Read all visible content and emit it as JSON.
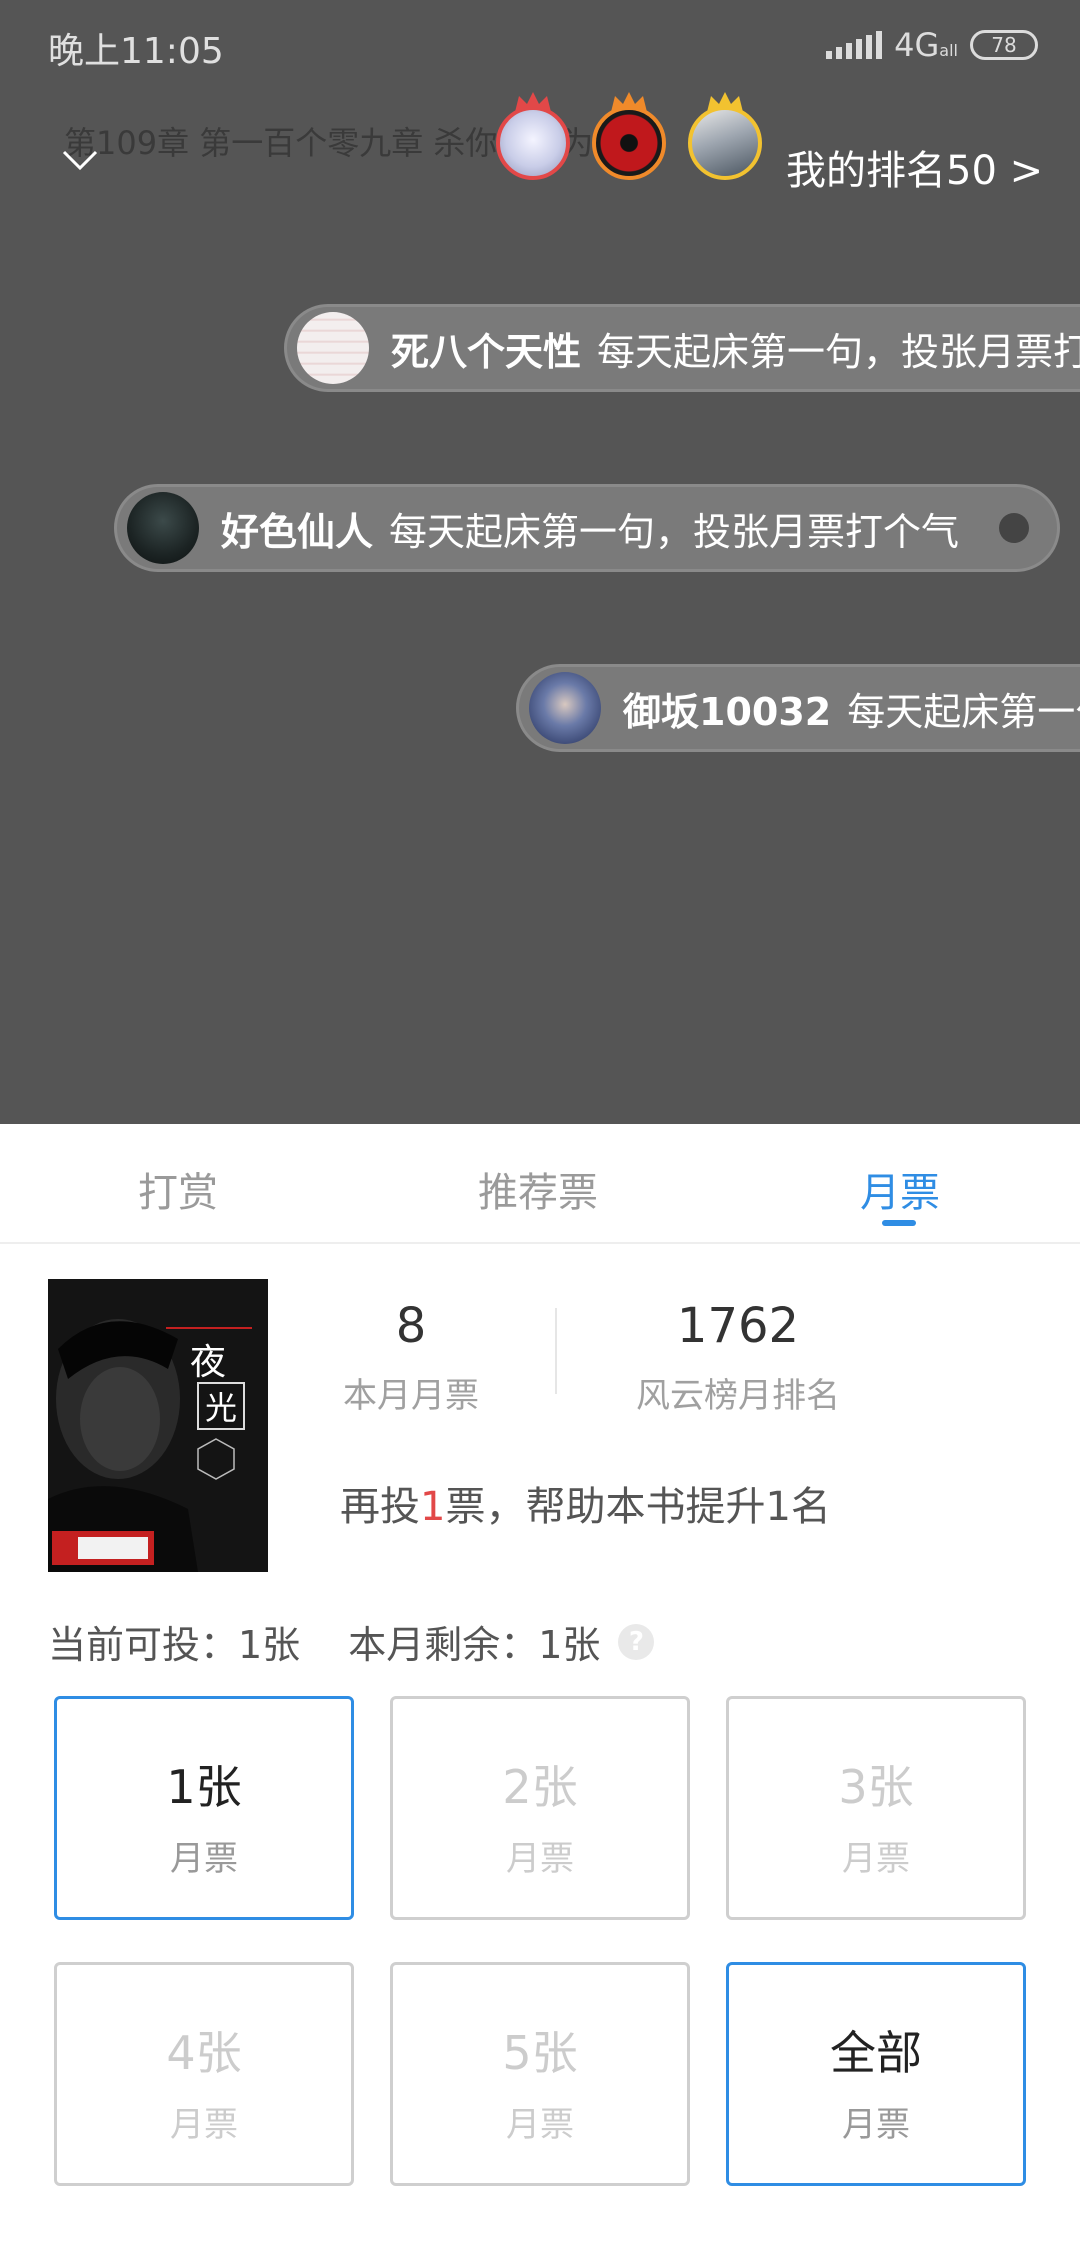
{
  "status_bar": {
    "time": "晚上11:05",
    "network": "4G",
    "network_sub": "all",
    "battery": "78"
  },
  "reader": {
    "chapter_title": "第109章 第一百个零九章 杀你，是为了",
    "my_rank_label": "我的排名50 >"
  },
  "danmaku": [
    {
      "name": "死八个天性",
      "message": "每天起床第一句，投张月票打个气"
    },
    {
      "name": "好色仙人",
      "message": "每天起床第一句，投张月票打个气"
    },
    {
      "name": "御坂10032",
      "message": "每天起床第一句，投张月票打个气"
    }
  ],
  "tabs": [
    {
      "label": "打赏",
      "active": false
    },
    {
      "label": "推荐票",
      "active": false
    },
    {
      "label": "月票",
      "active": true
    }
  ],
  "book": {
    "cover_title_1": "夜",
    "cover_title_2": "光",
    "monthly_votes": "8",
    "monthly_votes_label": "本月月票",
    "rank": "1762",
    "rank_label": "风云榜月排名",
    "boost_prefix": "再投",
    "boost_count": "1",
    "boost_suffix": "票，帮助本书提升1名"
  },
  "quota": {
    "current": "当前可投：1张",
    "remaining": "本月剩余：1张",
    "help": "?"
  },
  "options": [
    {
      "main": "1张",
      "sub": "月票"
    },
    {
      "main": "2张",
      "sub": "月票"
    },
    {
      "main": "3张",
      "sub": "月票"
    },
    {
      "main": "4张",
      "sub": "月票"
    },
    {
      "main": "5张",
      "sub": "月票"
    },
    {
      "main": "全部",
      "sub": "月票"
    }
  ],
  "colors": {
    "accent": "#2f8de4",
    "highlight": "#e24848",
    "overlay": "#555555"
  }
}
